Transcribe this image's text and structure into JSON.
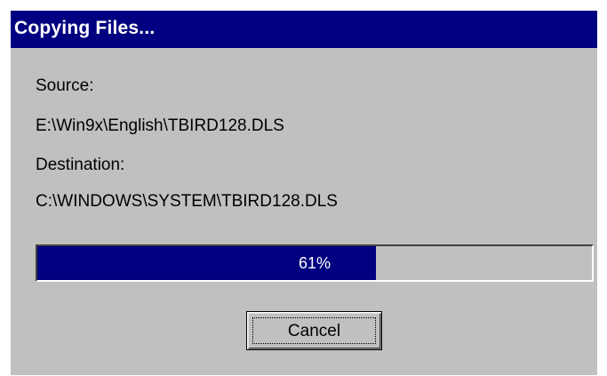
{
  "window": {
    "title": "Copying Files..."
  },
  "copy": {
    "source_label": "Source:",
    "source_path": "E:\\Win9x\\English\\TBIRD128.DLS",
    "destination_label": "Destination:",
    "destination_path": "C:\\WINDOWS\\SYSTEM\\TBIRD128.DLS"
  },
  "progress": {
    "percent": 61,
    "text": "61%"
  },
  "buttons": {
    "cancel_label": "Cancel"
  },
  "colors": {
    "titlebar": "#000080",
    "dialog_bg": "#c0c0c0",
    "progress_fill": "#000080"
  }
}
